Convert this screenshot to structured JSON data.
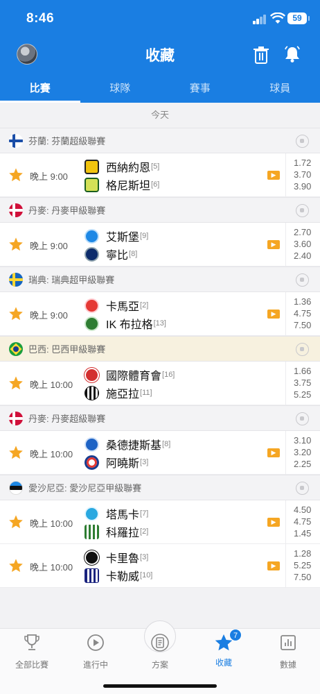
{
  "status": {
    "time": "8:46",
    "battery": "59"
  },
  "header": {
    "title": "收藏",
    "icons": [
      "avatar",
      "trash-icon",
      "bell-icon"
    ]
  },
  "tabs": [
    {
      "label": "比賽",
      "active": true
    },
    {
      "label": "球隊",
      "active": false
    },
    {
      "label": "賽事",
      "active": false
    },
    {
      "label": "球員",
      "active": false
    }
  ],
  "day_label": "今天",
  "leagues": [
    {
      "name": "芬蘭: 芬蘭超級聯賽",
      "flag": "finland",
      "matches": [
        {
          "time": "晚上 9:00",
          "home": "西納約恩",
          "home_rank": "[5]",
          "away": "格尼斯坦",
          "away_rank": "[6]",
          "odds": [
            "1.72",
            "3.70",
            "3.90"
          ]
        }
      ]
    },
    {
      "name": "丹麥: 丹麥甲級聯賽",
      "flag": "denmark",
      "matches": [
        {
          "time": "晚上 9:00",
          "home": "艾斯堡",
          "home_rank": "[9]",
          "away": "寧比",
          "away_rank": "[8]",
          "odds": [
            "2.70",
            "3.60",
            "2.40"
          ]
        }
      ]
    },
    {
      "name": "瑞典: 瑞典超甲級聯賽",
      "flag": "sweden",
      "matches": [
        {
          "time": "晚上 9:00",
          "home": "卡馬亞",
          "home_rank": "[2]",
          "away": "IK 布拉格",
          "away_rank": "[13]",
          "odds": [
            "1.36",
            "4.75",
            "7.50"
          ]
        }
      ]
    },
    {
      "name": "巴西: 巴西甲級聯賽",
      "flag": "brazil",
      "matches": [
        {
          "time": "晚上 10:00",
          "home": "國際體育會",
          "home_rank": "[16]",
          "away": "施亞拉",
          "away_rank": "[11]",
          "odds": [
            "1.66",
            "3.75",
            "5.25"
          ]
        }
      ]
    },
    {
      "name": "丹麥: 丹麥超級聯賽",
      "flag": "denmark",
      "matches": [
        {
          "time": "晚上 10:00",
          "home": "桑德捷斯基",
          "home_rank": "[8]",
          "away": "阿曉斯",
          "away_rank": "[3]",
          "odds": [
            "3.10",
            "3.20",
            "2.25"
          ]
        }
      ]
    },
    {
      "name": "愛沙尼亞: 愛沙尼亞甲級聯賽",
      "flag": "estonia",
      "matches": [
        {
          "time": "晚上 10:00",
          "home": "塔馬卡",
          "home_rank": "[7]",
          "away": "科羅拉",
          "away_rank": "[2]",
          "odds": [
            "4.50",
            "4.75",
            "1.45"
          ]
        },
        {
          "time": "晚上 10:00",
          "home": "卡里魯",
          "home_rank": "[3]",
          "away": "卡勒威",
          "away_rank": "[10]",
          "odds": [
            "1.28",
            "5.25",
            "7.50"
          ]
        }
      ]
    }
  ],
  "bottom_nav": [
    {
      "label": "全部比賽",
      "icon": "trophy-icon"
    },
    {
      "label": "進行中",
      "icon": "play-icon"
    },
    {
      "label": "方案",
      "icon": "document-icon"
    },
    {
      "label": "收藏",
      "icon": "star-icon",
      "badge": "7",
      "active": true
    },
    {
      "label": "數據",
      "icon": "chart-icon"
    }
  ],
  "colors": {
    "primary": "#1a7ee2",
    "star": "#f5a623",
    "tv": "#f5a623"
  }
}
